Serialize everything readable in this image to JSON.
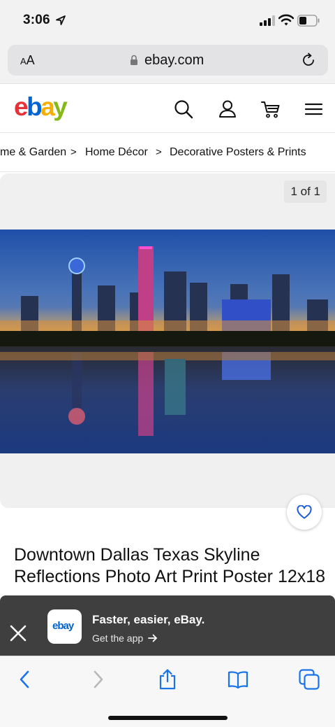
{
  "status": {
    "time": "3:06"
  },
  "browser": {
    "aa_label": "AA",
    "url": "ebay.com"
  },
  "header": {
    "logo": {
      "e": "e",
      "b": "b",
      "a": "a",
      "y": "y"
    },
    "icons": [
      "search-icon",
      "account-icon",
      "cart-icon",
      "menu-icon"
    ]
  },
  "breadcrumb": {
    "items": [
      "me & Garden",
      "Home Décor",
      "Decorative Posters & Prints"
    ],
    "separator": ">"
  },
  "gallery": {
    "counter": "1 of 1"
  },
  "listing": {
    "title": "Downtown Dallas Texas Skyline Reflections Photo Art Print Poster 12x18"
  },
  "app_banner": {
    "logo": "ebay",
    "title": "Faster, easier, eBay.",
    "subtitle": "Get the app"
  },
  "colors": {
    "ebay_red": "#e53238",
    "ebay_blue": "#0064d2",
    "ebay_yellow": "#f5af02",
    "ebay_green": "#86b817",
    "safari_blue": "#1a73e8",
    "banner_bg": "#3f3f3f"
  }
}
